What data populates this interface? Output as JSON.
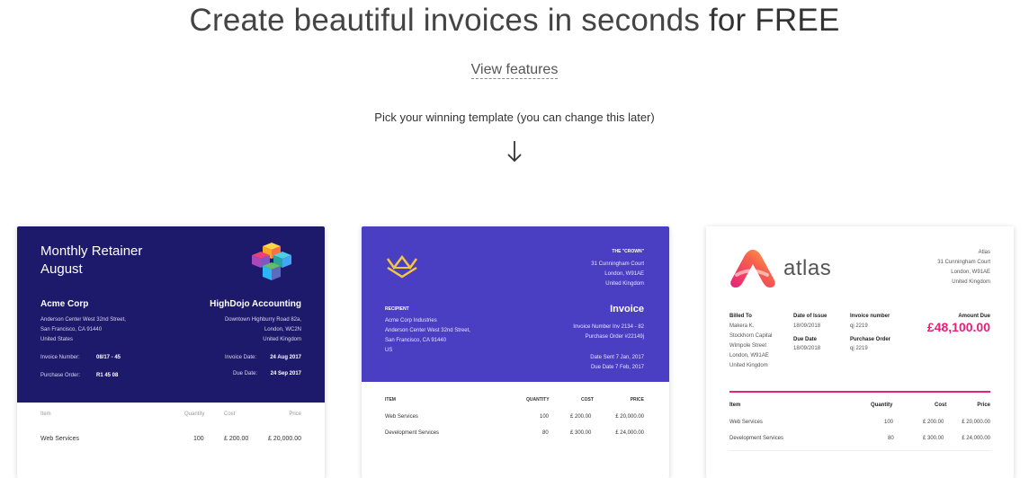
{
  "hero": {
    "title_light": "Create beautiful invoices in seconds",
    "title_bold": "for FREE",
    "view_features": "View features",
    "pick_text": "Pick your winning template (you can change this later)"
  },
  "templates": [
    {
      "accent": "#1d1a6b",
      "title_line1": "Monthly Retainer",
      "title_line2": "August",
      "from_name": "Acme Corp",
      "from_addr1": "Anderson Center West 32nd Street,",
      "from_addr2": "San Francisco, CA 91440",
      "from_addr3": "United States",
      "to_name": "HighDojo Accounting",
      "to_addr1": "Downtown Highburry Road 82a,",
      "to_addr2": "London, WC2N",
      "to_addr3": "United Kingdom",
      "invoice_number_label": "Invoice Number:",
      "invoice_number": "08/17 - 45",
      "purchase_order_label": "Purchase Order:",
      "purchase_order": "R1 45 08",
      "invoice_date_label": "Invoice Date:",
      "invoice_date": "24 Aug 2017",
      "due_date_label": "Due Date:",
      "due_date": "24 Sep 2017",
      "col_item": "Item",
      "col_qty": "Quantity",
      "col_cost": "Cost",
      "col_price": "Price",
      "row1": {
        "item": "Web Services",
        "qty": "100",
        "cost": "£ 200.00",
        "price": "£ 20,000.00"
      }
    },
    {
      "accent": "#4a3ec2",
      "crown_name": "THE \"CROWN\"",
      "crown_addr1": "31 Cunningham Court",
      "crown_addr2": "London, W91AE",
      "crown_addr3": "United Kingdom",
      "recipient_label": "RECIPIENT",
      "rec_addr1": "Acme Corp Industries",
      "rec_addr2": "Anderson Center West 32nd Street,",
      "rec_addr3": "San Francisco, CA 91440",
      "rec_addr4": "US",
      "invoice_title": "Invoice",
      "invoice_number_line": "Invoice Number   Inv 2134 - 82",
      "purchase_order_line": "Purchase Order   #22149j",
      "date_sent_line": "Date Sent   7 Jan, 2017",
      "due_date_line": "Due Date   7 Feb, 2017",
      "col_item": "ITEM",
      "col_qty": "QUANTITY",
      "col_cost": "COST",
      "col_price": "PRICE",
      "rows": [
        {
          "item": "Web Services",
          "qty": "100",
          "cost": "£ 200.00",
          "price": "£ 20,000.00"
        },
        {
          "item": "Development Services",
          "qty": "80",
          "cost": "£ 300.00",
          "price": "£ 24,000.00"
        }
      ]
    },
    {
      "accent": "#e7207a",
      "brand": "atlas",
      "comp_name": "Atlas",
      "comp_addr1": "31 Cunningham Court",
      "comp_addr2": "London, W91AE",
      "comp_addr3": "United Kingdom",
      "billed_to_label": "Billed To",
      "billed_name": "Makera K.",
      "billed_addr1": "Stockhorn Capital",
      "billed_addr2": "Wimpole Street",
      "billed_addr3": "London, W91AE",
      "billed_addr4": "United Kingdom",
      "date_issue_label": "Date of Issue",
      "date_issue": "18/09/2018",
      "due_date_label": "Due Date",
      "due_date": "18/09/2018",
      "invoice_number_label": "Invoice number",
      "invoice_number": "qj 2219",
      "purchase_order_label": "Purchase Order",
      "purchase_order": "qj 2219",
      "amount_due_label": "Amount Due",
      "amount_due": "£48,100.00",
      "col_item": "Item",
      "col_qty": "Quantity",
      "col_cost": "Cost",
      "col_price": "Price",
      "rows": [
        {
          "item": "Web Services",
          "qty": "100",
          "cost": "£ 200.00",
          "price": "£ 20,000.00"
        },
        {
          "item": "Development Services",
          "qty": "80",
          "cost": "£ 300.00",
          "price": "£ 24,000.00"
        }
      ]
    }
  ]
}
